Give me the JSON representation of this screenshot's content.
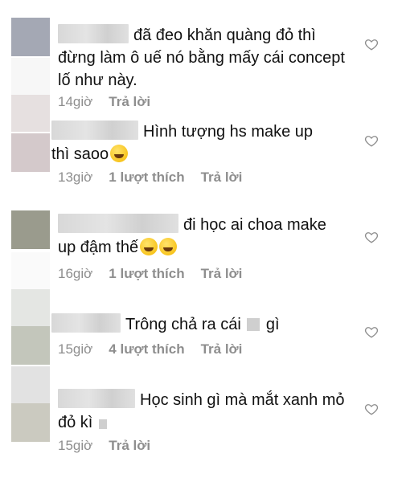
{
  "comments": [
    {
      "text_prefix": "",
      "text": "đã đeo khăn quàng đỏ thì đừng làm ô uế nó bằng mấy cái concept lố như này.",
      "time": "14giờ",
      "likes": "",
      "reply": "Trả lời",
      "avatar_color": "#a4a8b4"
    },
    {
      "text": "Hình tượng hs make up thì saoo",
      "time": "13giờ",
      "likes": "1 lượt thích",
      "reply": "Trả lời",
      "avatar_color": "#d4c9cb"
    },
    {
      "text": "đi học ai choa make up đậm thế",
      "time": "16giờ",
      "likes": "1 lượt thích",
      "reply": "Trả lời",
      "avatar_color": "#9a9b8d"
    },
    {
      "text_a": "Trông chả ra cái",
      "text_b": "gì",
      "time": "15giờ",
      "likes": "4 lượt thích",
      "reply": "Trả lời",
      "avatar_color": "#c3c6bb"
    },
    {
      "text": "Học sinh gì mà mắt xanh mỏ đỏ kì",
      "time": "15giờ",
      "likes": "",
      "reply": "Trả lời",
      "avatar_color": "#cbcac0"
    }
  ]
}
